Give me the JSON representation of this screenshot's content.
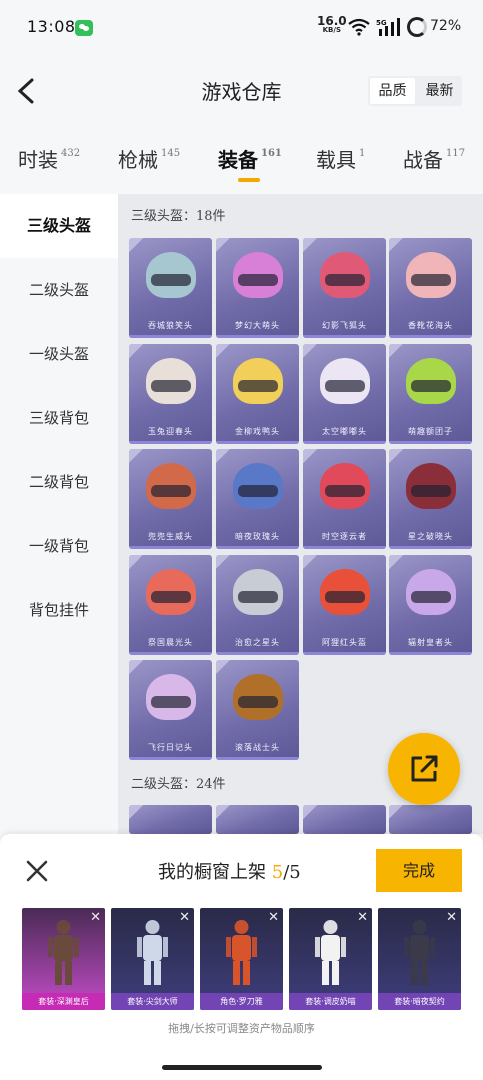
{
  "status": {
    "time": "13:08",
    "speed": "16.0",
    "speed_unit": "KB/S",
    "network": "5G",
    "battery": "72%"
  },
  "header": {
    "title": "游戏仓库",
    "sort_options": [
      "品质",
      "最新"
    ]
  },
  "tabs": [
    {
      "label": "时装",
      "count": "432"
    },
    {
      "label": "枪械",
      "count": "145"
    },
    {
      "label": "装备",
      "count": "161"
    },
    {
      "label": "载具",
      "count": "1"
    },
    {
      "label": "战备",
      "count": "117"
    }
  ],
  "sidebar": [
    "三级头盔",
    "二级头盔",
    "一级头盔",
    "三级背包",
    "二级背包",
    "一级背包",
    "背包挂件"
  ],
  "sections": [
    {
      "title": "三级头盔：18件"
    },
    {
      "title": "二级头盔：24件"
    }
  ],
  "items": [
    {
      "name": "吞城狼笑头",
      "color": "#a6c7cf"
    },
    {
      "name": "梦幻大萌头",
      "color": "#d880d8"
    },
    {
      "name": "幻影飞狐头",
      "color": "#e05a78"
    },
    {
      "name": "香靴花海头",
      "color": "#f0b5b8"
    },
    {
      "name": "玉兔迎春头",
      "color": "#e8e0d8"
    },
    {
      "name": "金柳戏鸭头",
      "color": "#f2cf58"
    },
    {
      "name": "太空嘟嘟头",
      "color": "#ece6f4"
    },
    {
      "name": "萌趣额团子",
      "color": "#a8d84a"
    },
    {
      "name": "兜兜生威头",
      "color": "#d26a4a"
    },
    {
      "name": "暗夜玫瑰头",
      "color": "#5a78c8"
    },
    {
      "name": "时空逐云者",
      "color": "#e04a5a"
    },
    {
      "name": "星之破晓头",
      "color": "#8a2e3a"
    },
    {
      "name": "祭国晨光头",
      "color": "#e86a5a"
    },
    {
      "name": "治愈之星头",
      "color": "#c8ccd4"
    },
    {
      "name": "阿狸红头盔",
      "color": "#e8503a"
    },
    {
      "name": "辐射皇者头",
      "color": "#c8a8e8"
    },
    {
      "name": "飞行日记头",
      "color": "#d8b8e8"
    },
    {
      "name": "滚落战士头",
      "color": "#b0702a"
    }
  ],
  "panel": {
    "title": "我的橱窗上架",
    "count": "5",
    "total": "/5",
    "done": "完成",
    "hint": "拖拽/长按可调整资产物品顺序"
  },
  "outfits": [
    {
      "label": "套装·深渊皇后",
      "color": "#6a4a3a"
    },
    {
      "label": "套装·尖剑大师",
      "color": "#cfd8e8"
    },
    {
      "label": "角色·罗刀雅",
      "color": "#d8542a"
    },
    {
      "label": "套装·调皮奶喵",
      "color": "#f2f2f2"
    },
    {
      "label": "套装·暗夜契约",
      "color": "#3a3a4a"
    }
  ]
}
